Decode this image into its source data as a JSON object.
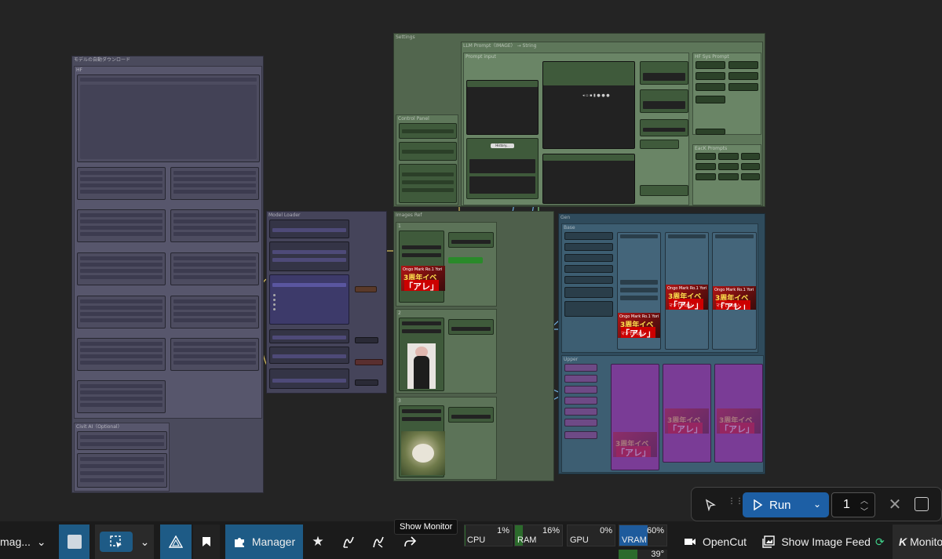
{
  "canvas": {
    "groups": {
      "model_download": "モデルの自動ダウンロード",
      "hf": "HF",
      "civitai": "Civit AI（Optional）",
      "model_loader": "Model Loader",
      "settings": "Settings",
      "llm_prompt": "LLM Prompt（IMAGE） → String",
      "prompt_input": "Prompt input",
      "control_panel": "Control Panel",
      "hf_sys_prompt": "HF Sys Prompt",
      "each_prompts": "EacK Prompts",
      "images_ref": "Images Ref",
      "ref_1": "1",
      "ref_2": "2",
      "ref_3": "3",
      "gen": "Gen",
      "base": "Base",
      "upper": "Upper"
    },
    "history_button": "History...",
    "thumbnail": {
      "line1": "Ongo Mark Ro.1 Yori",
      "line2": "3周年イベ",
      "line3": "「アレ」",
      "line4": "マジでやばい"
    },
    "colors": {
      "purple_group": "#4a4760",
      "green_group": "#4a5f46",
      "blue_group": "#2d4a5a",
      "violet_group": "#6a3c80",
      "wire_yellow": "#d8c060",
      "wire_green": "#7fd07f",
      "wire_blue": "#6fb0e0"
    }
  },
  "run_panel": {
    "run_label": "Run",
    "count": "1"
  },
  "tooltip": "Show Monitor",
  "taskbar": {
    "left_label": "mag...",
    "manager_label": "Manager",
    "meters": [
      {
        "name": "CPU",
        "pct": "1%",
        "value": 0.01,
        "color": "#2c6b2c"
      },
      {
        "name": "RAM",
        "pct": "16%",
        "value": 0.16,
        "color": "#2c6b2c"
      },
      {
        "name": "GPU",
        "pct": "0%",
        "value": 0.0,
        "color": "#2c6b2c"
      },
      {
        "name": "VRAM",
        "pct": "60%",
        "value": 0.6,
        "color": "#1e5b9c"
      }
    ],
    "temp": "39°",
    "opencut_label": "OpenCut",
    "image_feed_label": "Show Image Feed",
    "monitor_label": "Monito"
  }
}
